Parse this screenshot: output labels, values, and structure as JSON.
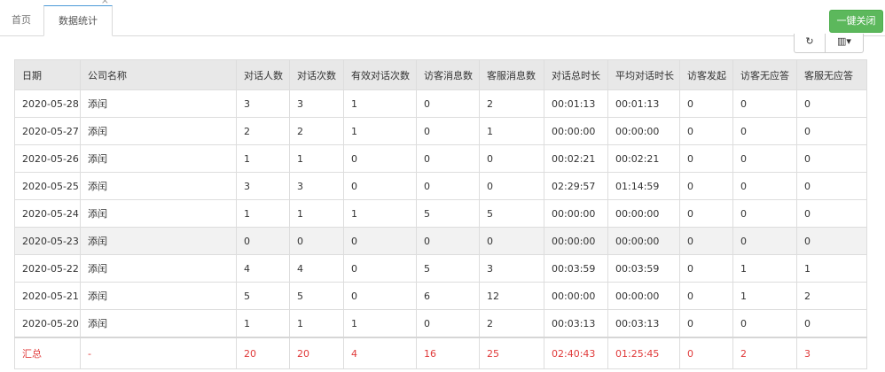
{
  "tabs": {
    "home_label": "首页",
    "active_label": "数据统计",
    "close_glyph": "×"
  },
  "close_all_label": "一键关闭",
  "toolbar": {
    "refresh_glyph": "↻",
    "columns_glyph": "▥▾"
  },
  "table": {
    "headers": [
      "日期",
      "公司名称",
      "对话人数",
      "对话次数",
      "有效对话次数",
      "访客消息数",
      "客服消息数",
      "对话总时长",
      "平均对话时长",
      "访客发起",
      "访客无应答",
      "客服无应答"
    ],
    "rows": [
      [
        "2020-05-28",
        "添闰",
        "3",
        "3",
        "1",
        "0",
        "2",
        "00:01:13",
        "00:01:13",
        "0",
        "0",
        "0"
      ],
      [
        "2020-05-27",
        "添闰",
        "2",
        "2",
        "1",
        "0",
        "1",
        "00:00:00",
        "00:00:00",
        "0",
        "0",
        "0"
      ],
      [
        "2020-05-26",
        "添闰",
        "1",
        "1",
        "0",
        "0",
        "0",
        "00:02:21",
        "00:02:21",
        "0",
        "0",
        "0"
      ],
      [
        "2020-05-25",
        "添闰",
        "3",
        "3",
        "0",
        "0",
        "0",
        "02:29:57",
        "01:14:59",
        "0",
        "0",
        "0"
      ],
      [
        "2020-05-24",
        "添闰",
        "1",
        "1",
        "1",
        "5",
        "5",
        "00:00:00",
        "00:00:00",
        "0",
        "0",
        "0"
      ],
      [
        "2020-05-23",
        "添闰",
        "0",
        "0",
        "0",
        "0",
        "0",
        "00:00:00",
        "00:00:00",
        "0",
        "0",
        "0"
      ],
      [
        "2020-05-22",
        "添闰",
        "4",
        "4",
        "0",
        "5",
        "3",
        "00:03:59",
        "00:03:59",
        "0",
        "1",
        "1"
      ],
      [
        "2020-05-21",
        "添闰",
        "5",
        "5",
        "0",
        "6",
        "12",
        "00:00:00",
        "00:00:00",
        "0",
        "1",
        "2"
      ],
      [
        "2020-05-20",
        "添闰",
        "1",
        "1",
        "1",
        "0",
        "2",
        "00:03:13",
        "00:03:13",
        "0",
        "0",
        "0"
      ]
    ],
    "total": [
      "汇总",
      "-",
      "20",
      "20",
      "4",
      "16",
      "25",
      "02:40:43",
      "01:25:45",
      "0",
      "2",
      "3"
    ]
  },
  "colors": {
    "accent_green": "#5cb85c",
    "total_red": "#e03a3a",
    "header_bg": "#e8e8e8"
  }
}
